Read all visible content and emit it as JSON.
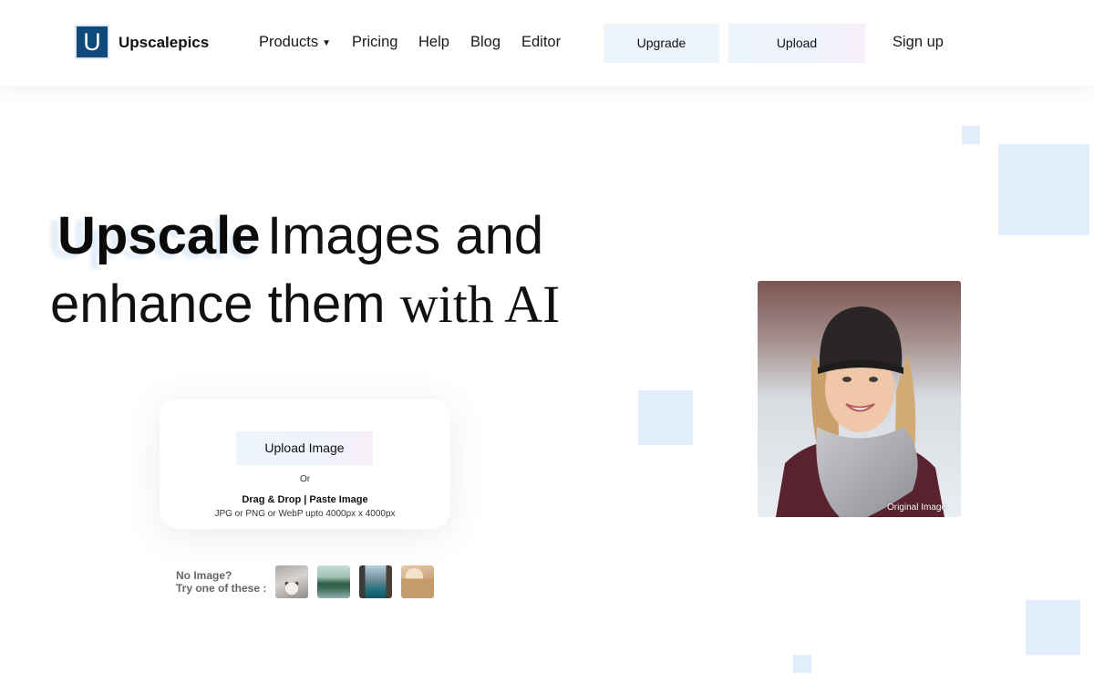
{
  "brand": {
    "logo_letter": "U",
    "name": "Upscalepics"
  },
  "nav": {
    "items": [
      {
        "label": "Products",
        "has_dropdown": true
      },
      {
        "label": "Pricing"
      },
      {
        "label": "Help"
      },
      {
        "label": "Blog"
      },
      {
        "label": "Editor"
      }
    ],
    "upgrade_label": "Upgrade",
    "upload_label": "Upload",
    "signup_label": "Sign up"
  },
  "hero": {
    "highlight_word": "Upscale",
    "line1_rest": "Images and",
    "line2_plain": "enhance them",
    "line2_serif": "with AI"
  },
  "upload_card": {
    "button_label": "Upload Image",
    "or_text": "Or",
    "drag_drop_text": "Drag & Drop | Paste Image",
    "formats_text": "JPG or PNG or WebP upto 4000px x 4000px"
  },
  "samples": {
    "prompt_line1": "No Image?",
    "prompt_line2": "Try one of these :",
    "thumbnails": [
      "cat",
      "lake",
      "canal",
      "desk"
    ]
  },
  "preview": {
    "label": "Original Image"
  },
  "colors": {
    "logo_bg": "#0f4a7b",
    "button_tint": "#eef4fc",
    "decor_square": "#e1edfa"
  }
}
